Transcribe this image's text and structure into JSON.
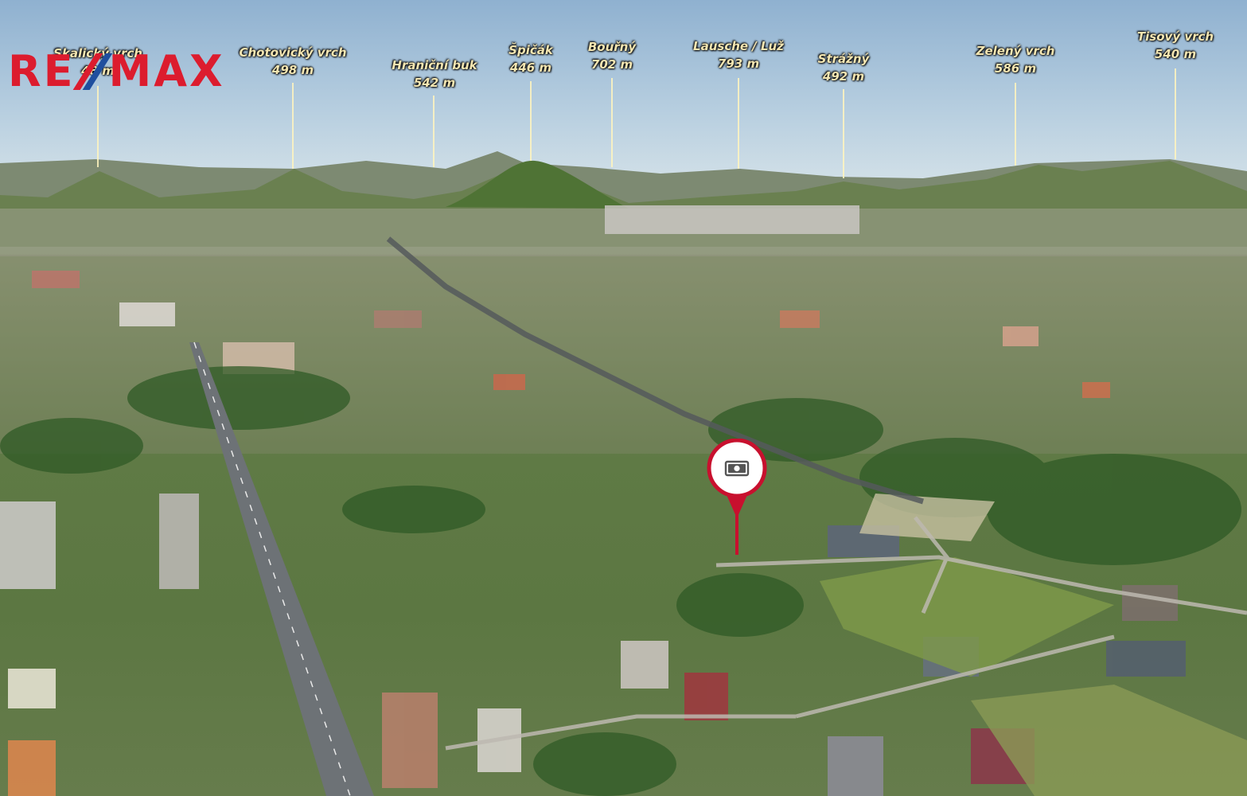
{
  "brand": {
    "logo_text_left": "RE",
    "logo_text_right": "MAX",
    "logo_color": "#dc1c2e",
    "logo_slash_colors": [
      "#dc1c2e",
      "#1f4f9e"
    ]
  },
  "peaks": [
    {
      "name": "Skalický vrch",
      "elevation": "48 m"
    },
    {
      "name": "Chotovický vrch",
      "elevation": "498 m"
    },
    {
      "name": "Hraniční buk",
      "elevation": "542 m"
    },
    {
      "name": "Špičák",
      "elevation": "446 m"
    },
    {
      "name": "Bouřný",
      "elevation": "702 m"
    },
    {
      "name": "Lausche / Luž",
      "elevation": "793 m"
    },
    {
      "name": "Strážný",
      "elevation": "492 m"
    },
    {
      "name": "Zelený vrch",
      "elevation": "586 m"
    },
    {
      "name": "Tisový vrch",
      "elevation": "540 m"
    }
  ],
  "marker": {
    "icon": "money-icon",
    "color": "#c8102e"
  },
  "colors": {
    "label_text": "#f4e6b2",
    "road": "#6d7276"
  }
}
